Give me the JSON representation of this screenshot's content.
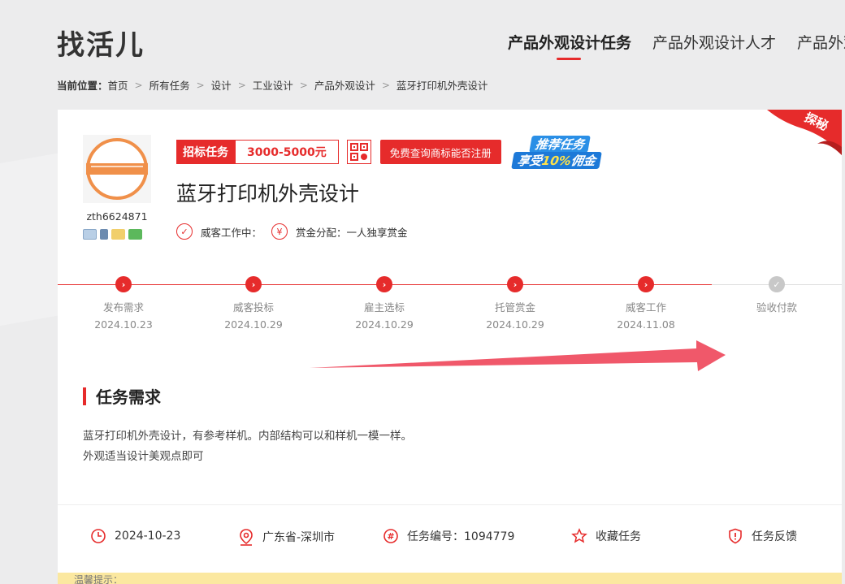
{
  "header": {
    "logo": "找活儿",
    "nav": [
      "产品外观设计任务",
      "产品外观设计人才",
      "产品外观"
    ]
  },
  "breadcrumb": {
    "label": "当前位置：",
    "items": [
      "首页",
      "所有任务",
      "设计",
      "工业设计",
      "产品外观设计",
      "蓝牙打印机外壳设计"
    ]
  },
  "employer": {
    "username": "zth6624871"
  },
  "task": {
    "type_tag": "招标任务",
    "price": "3000-5000元",
    "trademark_button": "免费查询商标能否注册",
    "promo_line1": "推荐任务",
    "promo_line2a": "享受",
    "promo_line2b": "10%",
    "promo_line2c": "佣金",
    "title": "蓝牙打印机外壳设计",
    "status": "威客工作中：",
    "reward_mode": "赏金分配：一人独享赏金",
    "corner_badge": "探秘"
  },
  "progress": {
    "steps": [
      {
        "label": "发布需求",
        "date": "2024.10.23"
      },
      {
        "label": "威客投标",
        "date": "2024.10.29"
      },
      {
        "label": "雇主选标",
        "date": "2024.10.29"
      },
      {
        "label": "托管赏金",
        "date": "2024.10.29"
      },
      {
        "label": "威客工作",
        "date": "2024.11.08"
      },
      {
        "label": "验收付款",
        "date": ""
      }
    ]
  },
  "requirement": {
    "heading": "任务需求",
    "line1": "蓝牙打印机外壳设计，有参考样机。内部结构可以和样机一模一样。",
    "line2": "外观适当设计美观点即可"
  },
  "info": {
    "date": "2024-10-23",
    "location": "广东省-深圳市",
    "task_no": "任务编号：1094779",
    "favorite": "收藏任务",
    "feedback": "任务反馈"
  },
  "notice": "温馨提示：",
  "colors": {
    "accent": "#e62b2b",
    "pending": "#c8c8c8"
  }
}
